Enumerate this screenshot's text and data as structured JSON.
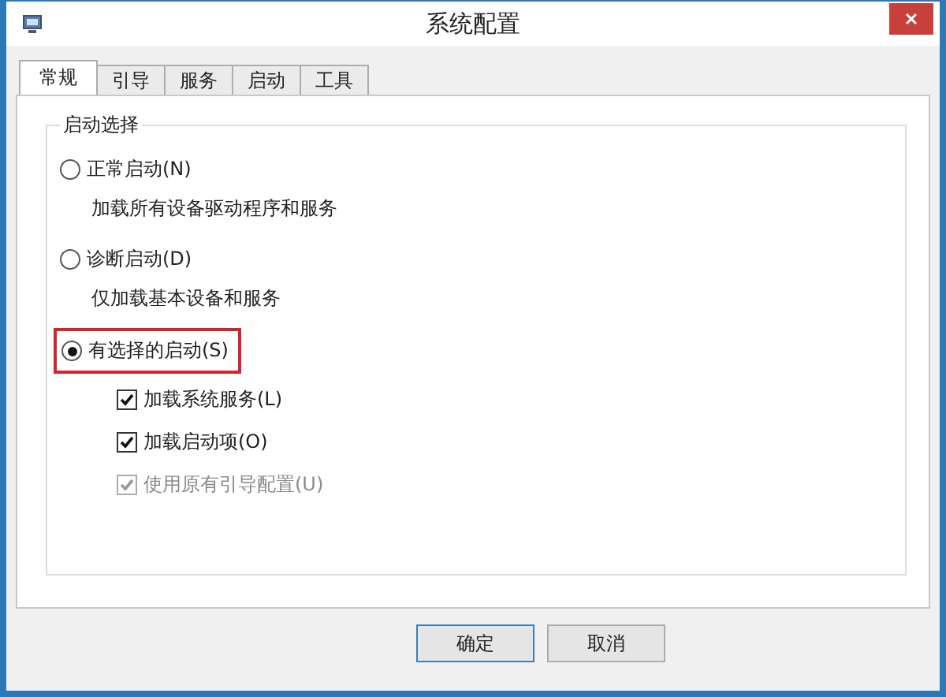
{
  "window": {
    "title": "系统配置"
  },
  "tabs": [
    {
      "label": "常规",
      "selected": true
    },
    {
      "label": "引导",
      "selected": false
    },
    {
      "label": "服务",
      "selected": false
    },
    {
      "label": "启动",
      "selected": false
    },
    {
      "label": "工具",
      "selected": false
    }
  ],
  "group": {
    "title": "启动选择"
  },
  "options": [
    {
      "label": "正常启动(N)",
      "description": "加载所有设备驱动程序和服务",
      "selected": false,
      "highlighted": false
    },
    {
      "label": "诊断启动(D)",
      "description": "仅加载基本设备和服务",
      "selected": false,
      "highlighted": false
    },
    {
      "label": "有选择的启动(S)",
      "selected": true,
      "highlighted": true
    }
  ],
  "checkboxes": [
    {
      "label": "加载系统服务(L)",
      "checked": true,
      "disabled": false
    },
    {
      "label": "加载启动项(O)",
      "checked": true,
      "disabled": false
    },
    {
      "label": "使用原有引导配置(U)",
      "checked": true,
      "disabled": true
    }
  ],
  "buttons": [
    {
      "label": "确定",
      "default": true
    },
    {
      "label": "取消",
      "default": false
    }
  ]
}
